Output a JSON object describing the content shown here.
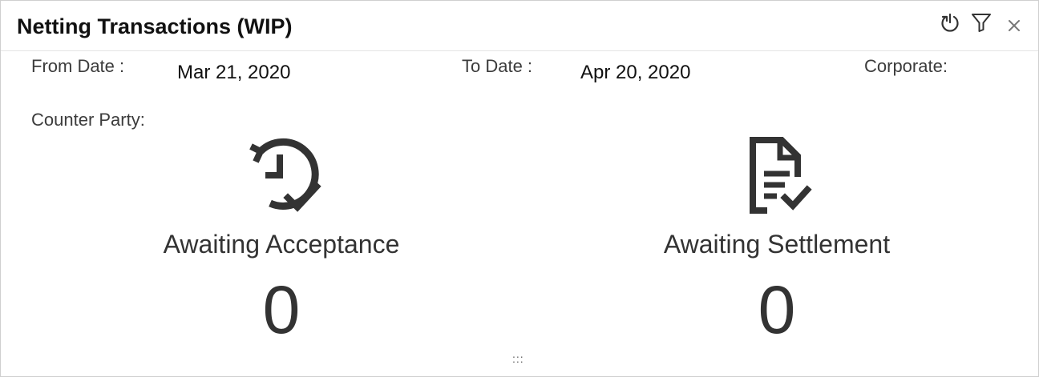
{
  "widget": {
    "title": "Netting Transactions (WIP)",
    "header_icons": [
      "refresh-icon",
      "filter-icon",
      "close-icon"
    ]
  },
  "filters": {
    "from_date_label": "From Date :",
    "from_date_value": "Mar 21, 2020",
    "to_date_label": "To Date :",
    "to_date_value": "Apr 20, 2020",
    "corporate_label": "Corporate:",
    "counter_party_label": "Counter Party:"
  },
  "cards": [
    {
      "label": "Awaiting Acceptance",
      "count": "0",
      "icon": "history-check-icon"
    },
    {
      "label": "Awaiting Settlement",
      "count": "0",
      "icon": "document-check-icon"
    }
  ],
  "drag_handle": ":::",
  "colors": {
    "icon": "#333333",
    "text": "#333333",
    "border": "#cfcfcf"
  }
}
